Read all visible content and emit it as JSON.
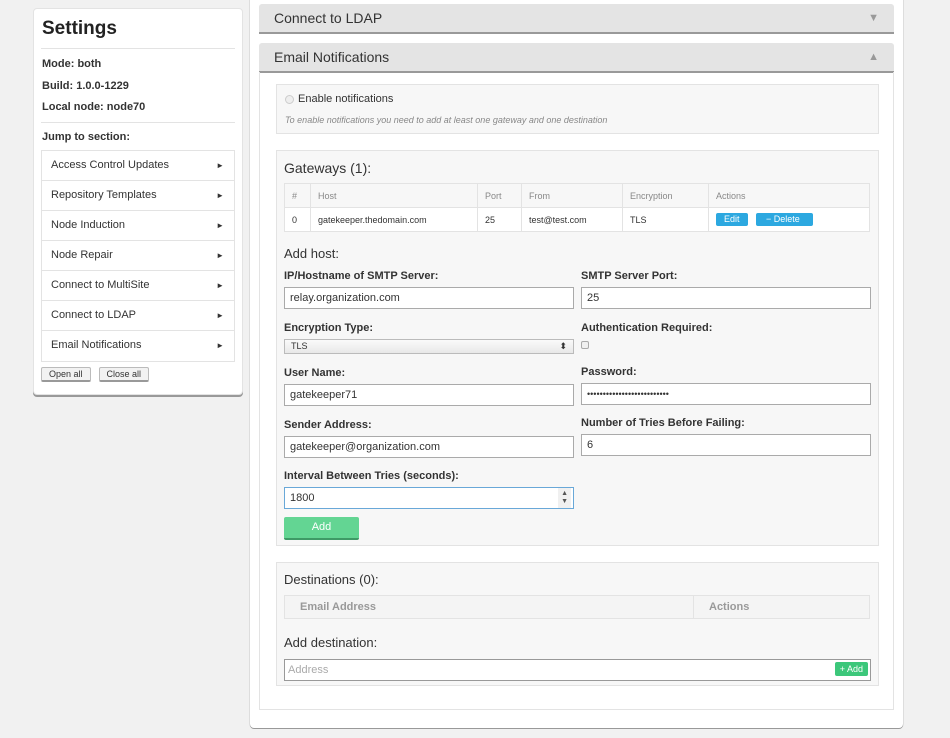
{
  "sidebar": {
    "title": "Settings",
    "mode": "Mode: both",
    "build": "Build: 1.0.0-1229",
    "local_node": "Local node: node70",
    "jump_label": "Jump to section:",
    "arrow_glyph": "►",
    "items": [
      {
        "label": "Access Control Updates"
      },
      {
        "label": "Repository Templates"
      },
      {
        "label": "Node Induction"
      },
      {
        "label": "Node Repair"
      },
      {
        "label": "Connect to MultiSite"
      },
      {
        "label": "Connect to LDAP"
      },
      {
        "label": "Email Notifications"
      }
    ],
    "open_all": "Open all",
    "close_all": "Close all"
  },
  "sections": {
    "ldap": {
      "title": "Connect to LDAP",
      "caret": "▼",
      "state": "collapsed"
    },
    "email": {
      "title": "Email Notifications",
      "caret": "▲",
      "state": "expanded"
    }
  },
  "email": {
    "enable_label": "Enable notifications",
    "enable_checked": false,
    "hint": "To enable notifications you need to add at least one gateway and one destination",
    "gateways": {
      "title": "Gateways (1):",
      "columns": [
        "#",
        "Host",
        "Port",
        "From",
        "Encryption",
        "Actions"
      ],
      "rows": [
        {
          "index": "0",
          "host": "gatekeeper.thedomain.com",
          "port": "25",
          "from": "test@test.com",
          "encryption": "TLS"
        }
      ],
      "edit_label": "Edit",
      "delete_label": "− Delete"
    },
    "add_host": {
      "title": "Add host:",
      "hostname_label": "IP/Hostname of SMTP Server:",
      "hostname_value": "relay.organization.com",
      "port_label": "SMTP Server Port:",
      "port_value": "25",
      "encryption_label": "Encryption Type:",
      "encryption_value": "TLS",
      "auth_label": "Authentication Required:",
      "auth_checked": false,
      "username_label": "User Name:",
      "username_value": "gatekeeper71",
      "password_label": "Password:",
      "password_value": "••••••••••••••••••••••••••",
      "sender_label": "Sender Address:",
      "sender_value": "gatekeeper@organization.com",
      "tries_label": "Number of Tries Before Failing:",
      "tries_value": "6",
      "interval_label": "Interval Between Tries (seconds):",
      "interval_value": "1800",
      "add_label": "Add"
    },
    "destinations": {
      "title": "Destinations (0):",
      "columns": [
        "Email Address",
        "Actions"
      ],
      "add_title": "Add destination:",
      "address_placeholder": "Address",
      "add_label": "+ Add"
    }
  },
  "colors": {
    "action_blue": "#2ca8e0",
    "add_green": "#63d593",
    "inline_add_green": "#3cc77a"
  }
}
